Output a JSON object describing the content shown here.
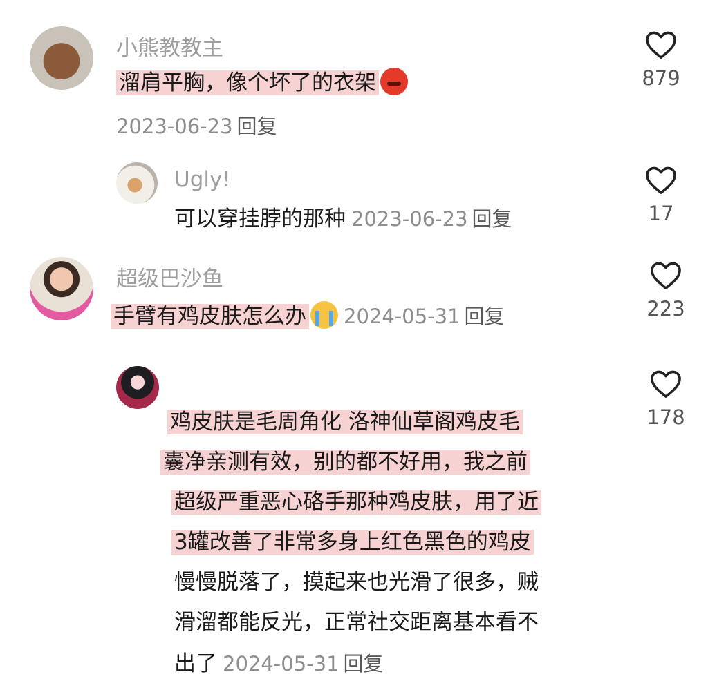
{
  "icons": {
    "like": "heart-outline-icon"
  },
  "colors": {
    "highlight": "#f7d2d2",
    "muted": "#9e9e9e"
  },
  "comments": [
    {
      "username": "小熊教教主",
      "text": "溜肩平胸，像个坏了的衣架",
      "emoji": "angry-devil-emoji",
      "date": "2023-06-23",
      "reply": "回复",
      "likes": "879"
    },
    {
      "username": "Ugly!",
      "text": "可以穿挂脖的那种",
      "date": "2023-06-23",
      "reply": "回复",
      "likes": "17"
    },
    {
      "username": "超级巴沙鱼",
      "text": "手臂有鸡皮肤怎么办",
      "emoji": "crying-face-emoji",
      "date": "2024-05-31",
      "reply": "回复",
      "likes": "223"
    },
    {
      "username": "",
      "lines": [
        "鸡皮肤是毛周角化 洛神仙草阁鸡皮毛",
        "囊净亲测有效，别的都不好用，我之前",
        "超级严重恶心硌手那种鸡皮肤，用了近",
        "3罐改善了非常多身上红色黑色的鸡皮",
        "慢慢脱落了，摸起来也光滑了很多，贼",
        "滑溜都能反光，正常社交距离基本看不",
        "出了"
      ],
      "date": "2024-05-31",
      "reply": "回复",
      "likes": "178"
    }
  ]
}
